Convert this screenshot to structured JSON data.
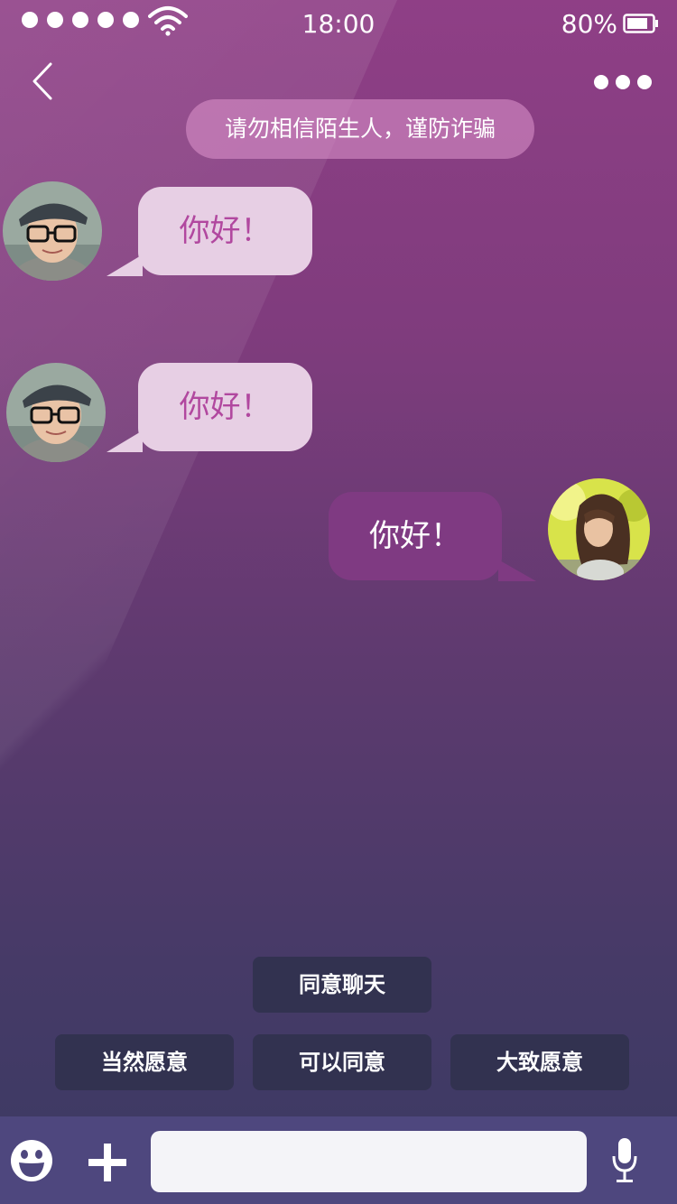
{
  "status_bar": {
    "time": "18:00",
    "battery_percent": "80%",
    "signal_dots": 5,
    "icons": [
      "wifi-icon",
      "battery-icon"
    ]
  },
  "nav": {
    "icons": [
      "back-icon",
      "more-icon"
    ]
  },
  "notice": "请勿相信陌生人，谨防诈骗",
  "messages": [
    {
      "side": "left",
      "text": "你好！",
      "avatar": "boy-avatar"
    },
    {
      "side": "left",
      "text": "你好！",
      "avatar": "boy-avatar"
    },
    {
      "side": "right",
      "text": "你好！",
      "avatar": "girl-avatar"
    }
  ],
  "quick_replies": [
    "同意聊天",
    "当然愿意",
    "可以同意",
    "大致愿意"
  ],
  "input_bar": {
    "placeholder": "",
    "icons": [
      "emoji-icon",
      "plus-icon",
      "microphone-icon"
    ]
  },
  "colors": {
    "background_top": "#8f3f86",
    "background_bottom": "#3b3a63",
    "incoming_bubble": "#e7cfe4",
    "incoming_text": "#b1489f",
    "outgoing_bubble": "#7f3a82",
    "quick_reply_bg": "#323250",
    "input_bar_bg": "#4e477e"
  }
}
